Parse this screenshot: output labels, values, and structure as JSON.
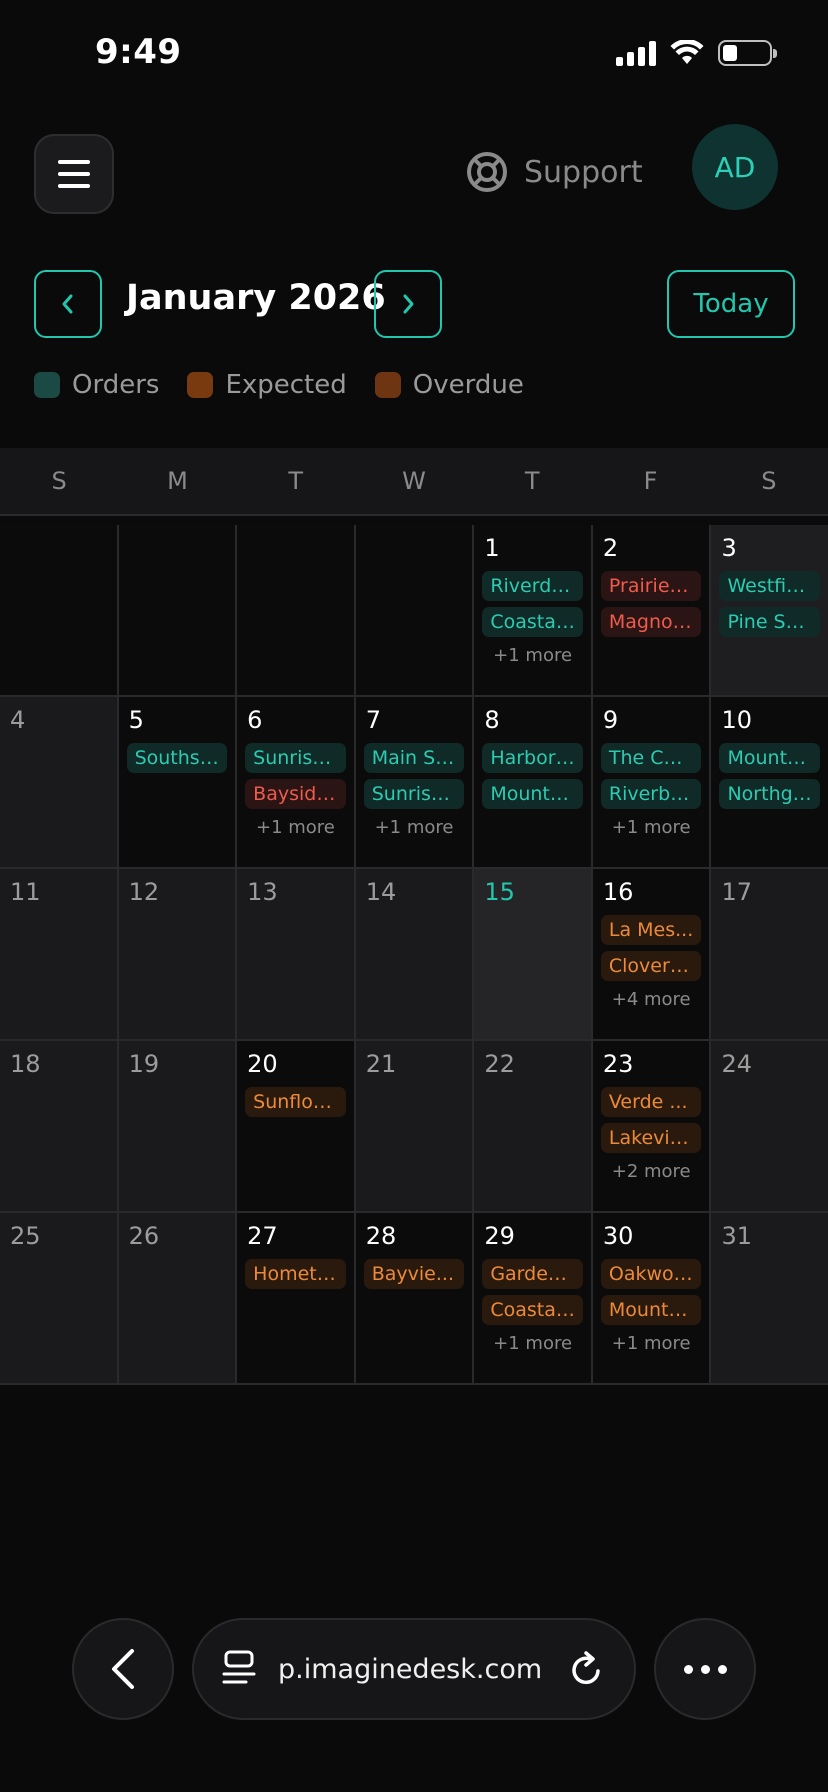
{
  "status": {
    "time": "9:49"
  },
  "header": {
    "support_label": "Support",
    "avatar_initials": "AD"
  },
  "calendar": {
    "month_title": "January 2026",
    "today_label": "Today",
    "legend": [
      {
        "label": "Orders",
        "color": "#1b4a45"
      },
      {
        "label": "Expected",
        "color": "#7a3a10"
      },
      {
        "label": "Overdue",
        "color": "#6e3512"
      }
    ],
    "weekdays": [
      "S",
      "M",
      "T",
      "W",
      "T",
      "F",
      "S"
    ],
    "weeks": [
      [
        {
          "day": "",
          "kind": "empty",
          "events": []
        },
        {
          "day": "",
          "kind": "empty",
          "events": []
        },
        {
          "day": "",
          "kind": "empty",
          "events": []
        },
        {
          "day": "",
          "kind": "empty",
          "events": []
        },
        {
          "day": "1",
          "kind": "inmonth",
          "events": [
            {
              "label": "Riverdal...",
              "type": "order"
            },
            {
              "label": "Coastal...",
              "type": "order"
            }
          ],
          "more": "+1 more"
        },
        {
          "day": "2",
          "kind": "inmonth",
          "events": [
            {
              "label": "Prairie F...",
              "type": "overdue"
            },
            {
              "label": "Magnoli...",
              "type": "overdue"
            }
          ]
        },
        {
          "day": "3",
          "kind": "weekend-sel",
          "events": [
            {
              "label": "Westfiel...",
              "type": "order"
            },
            {
              "label": "Pine Str...",
              "type": "order"
            }
          ]
        }
      ],
      [
        {
          "day": "4",
          "kind": "past",
          "events": []
        },
        {
          "day": "5",
          "kind": "inmonth",
          "events": [
            {
              "label": "Southsi...",
              "type": "order"
            }
          ]
        },
        {
          "day": "6",
          "kind": "inmonth",
          "events": [
            {
              "label": "Sunrise ...",
              "type": "order"
            },
            {
              "label": "Bayside...",
              "type": "overdue"
            }
          ],
          "more": "+1 more"
        },
        {
          "day": "7",
          "kind": "inmonth",
          "events": [
            {
              "label": "Main St...",
              "type": "order"
            },
            {
              "label": "Sunrise ...",
              "type": "order"
            }
          ],
          "more": "+1 more"
        },
        {
          "day": "8",
          "kind": "inmonth",
          "events": [
            {
              "label": "Harbor ...",
              "type": "order"
            },
            {
              "label": "Mounta...",
              "type": "order"
            }
          ]
        },
        {
          "day": "9",
          "kind": "inmonth",
          "events": [
            {
              "label": "The Cor...",
              "type": "order"
            },
            {
              "label": "Riverbe...",
              "type": "order"
            }
          ],
          "more": "+1 more"
        },
        {
          "day": "10",
          "kind": "inmonth",
          "events": [
            {
              "label": "Mounta...",
              "type": "order"
            },
            {
              "label": "Northga...",
              "type": "order"
            }
          ]
        }
      ],
      [
        {
          "day": "11",
          "kind": "past",
          "events": []
        },
        {
          "day": "12",
          "kind": "past",
          "events": []
        },
        {
          "day": "13",
          "kind": "past",
          "events": []
        },
        {
          "day": "14",
          "kind": "past",
          "events": []
        },
        {
          "day": "15",
          "kind": "today",
          "events": []
        },
        {
          "day": "16",
          "kind": "inmonth",
          "events": [
            {
              "label": "La Mes...",
              "type": "expected"
            },
            {
              "label": "Clover ...",
              "type": "expected"
            }
          ],
          "more": "+4 more"
        },
        {
          "day": "17",
          "kind": "past",
          "events": []
        }
      ],
      [
        {
          "day": "18",
          "kind": "past",
          "events": []
        },
        {
          "day": "19",
          "kind": "past",
          "events": []
        },
        {
          "day": "20",
          "kind": "inmonth",
          "events": [
            {
              "label": "Sunflow...",
              "type": "expected"
            }
          ]
        },
        {
          "day": "21",
          "kind": "past",
          "events": []
        },
        {
          "day": "22",
          "kind": "past",
          "events": []
        },
        {
          "day": "23",
          "kind": "inmonth",
          "events": [
            {
              "label": "Verde ...",
              "type": "expected"
            },
            {
              "label": "Lakevie...",
              "type": "expected"
            }
          ],
          "more": "+2 more"
        },
        {
          "day": "24",
          "kind": "past",
          "events": []
        }
      ],
      [
        {
          "day": "25",
          "kind": "past",
          "events": []
        },
        {
          "day": "26",
          "kind": "past",
          "events": []
        },
        {
          "day": "27",
          "kind": "inmonth",
          "events": [
            {
              "label": "Hometo...",
              "type": "expected"
            }
          ]
        },
        {
          "day": "28",
          "kind": "inmonth",
          "events": [
            {
              "label": "Bayvie...",
              "type": "expected"
            }
          ]
        },
        {
          "day": "29",
          "kind": "inmonth",
          "events": [
            {
              "label": "Garden ...",
              "type": "expected"
            },
            {
              "label": "Coastal...",
              "type": "expected"
            }
          ],
          "more": "+1 more"
        },
        {
          "day": "30",
          "kind": "inmonth",
          "events": [
            {
              "label": "Oakwoo...",
              "type": "expected"
            },
            {
              "label": "Mounta...",
              "type": "expected"
            }
          ],
          "more": "+1 more"
        },
        {
          "day": "31",
          "kind": "past",
          "events": []
        }
      ]
    ]
  },
  "browser": {
    "url": "p.imaginedesk.com"
  }
}
